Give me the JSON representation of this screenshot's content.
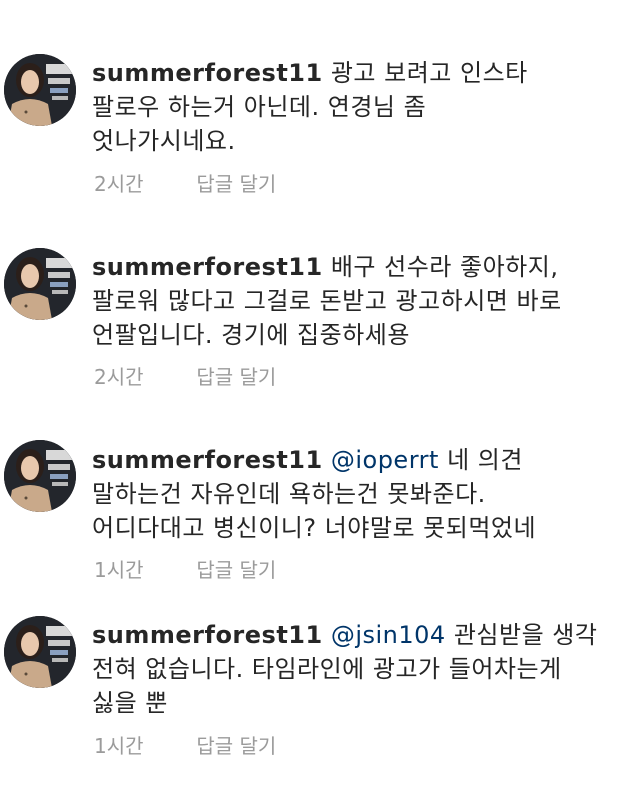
{
  "comments": [
    {
      "username": "summerforest11",
      "mention": "",
      "text": "광고 보려고 인스타",
      "lines": [
        "팔로우 하는거 아닌데. 연경님 좀",
        "엇나가시네요."
      ],
      "time": "2시간",
      "reply_label": "답글 달기"
    },
    {
      "username": "summerforest11",
      "mention": "",
      "text": "배구 선수라 좋아하지,",
      "lines": [
        "팔로워 많다고 그걸로 돈받고 광고하시면 바로",
        "언팔입니다. 경기에 집중하세용"
      ],
      "time": "2시간",
      "reply_label": "답글 달기"
    },
    {
      "username": "summerforest11",
      "mention": "@ioperrt",
      "text": "네 의견",
      "lines": [
        "말하는건 자유인데 욕하는건 못봐준다.",
        "어디다대고 병신이니? 너야말로 못되먹었네"
      ],
      "time": "1시간",
      "reply_label": "답글 달기"
    },
    {
      "username": "summerforest11",
      "mention": "@jsin104",
      "text": "관심받을 생각",
      "lines": [
        "전혀 없습니다. 타임라인에 광고가 들어차는게",
        "싫을 뿐"
      ],
      "time": "1시간",
      "reply_label": "답글 달기"
    }
  ]
}
